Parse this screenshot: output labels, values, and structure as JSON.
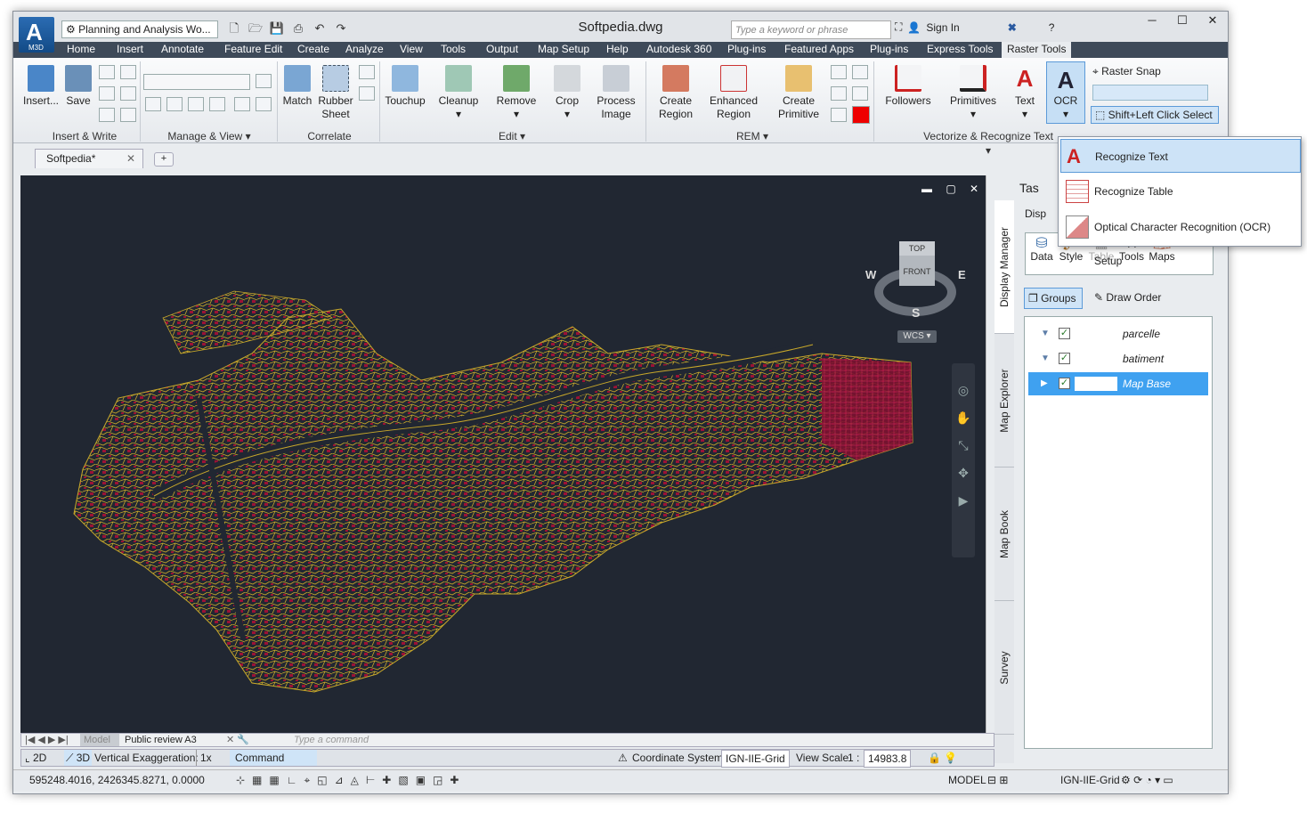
{
  "app": {
    "logo": "A",
    "logo_sub": "M3D",
    "workspace": "Planning and Analysis Wo...",
    "title": "Softpedia.dwg",
    "search_placeholder": "Type a keyword or phrase",
    "sign_in": "Sign In"
  },
  "tabs": [
    "Home",
    "Insert",
    "Annotate",
    "Feature Edit",
    "Create",
    "Analyze",
    "View",
    "Tools",
    "Output",
    "Map Setup",
    "Help",
    "Autodesk 360",
    "Plug-ins",
    "Featured Apps",
    "Plug-ins",
    "Express Tools",
    "Raster Tools"
  ],
  "ribbon": {
    "insert_write": {
      "insert": "Insert...",
      "save": "Save",
      "panel": "Insert & Write"
    },
    "manage_view": {
      "panel": "Manage & View"
    },
    "correlate": {
      "match": "Match",
      "rubber": "Rubber",
      "sheet": "Sheet",
      "panel": "Correlate"
    },
    "edit": {
      "touchup": "Touchup",
      "cleanup": "Cleanup",
      "remove": "Remove",
      "crop": "Crop",
      "process": "Process",
      "image": "Image",
      "panel": "Edit"
    },
    "rem": {
      "create": "Create",
      "region": "Region",
      "enhanced": "Enhanced",
      "enh_region": "Region",
      "create2": "Create",
      "primitive": "Primitive",
      "panel": "REM"
    },
    "vector": {
      "followers": "Followers",
      "primitives": "Primitives",
      "text": "Text",
      "ocr": "OCR",
      "panel": "Vectorize & Recognize Text",
      "raster_snap": "Raster Snap",
      "shift_select": "Shift+Left Click Select"
    }
  },
  "doc_tab": "Softpedia*",
  "compass": {
    "top": "TOP",
    "front": "FRONT",
    "n": "",
    "w": "W",
    "e": "E",
    "s": "S",
    "wcs": "WCS"
  },
  "ocr_menu": [
    "Recognize Text",
    "Recognize Table",
    "Optical Character Recognition (OCR) Setup"
  ],
  "palette": {
    "title": "Tas",
    "display_tab": "Disp",
    "vtabs": [
      "Display Manager",
      "Map Explorer",
      "Map Book",
      "Survey"
    ],
    "tools": [
      "Data",
      "Style",
      "Table",
      "Tools",
      "Maps"
    ],
    "groups": "Groups",
    "draw_order": "Draw Order",
    "layers": [
      {
        "name": "parcelle",
        "checked": true
      },
      {
        "name": "batiment",
        "checked": true
      },
      {
        "name": "Map Base",
        "checked": true
      }
    ]
  },
  "layout_tabs": {
    "model": "Model",
    "layout": "Public review A3"
  },
  "command": {
    "placeholder": "Type  a  command",
    "label": "Command"
  },
  "status": {
    "d2": "2D",
    "d3": "3D",
    "vert": "Vertical Exaggeration:",
    "vert_val": "1x",
    "coord_label": "Coordinate System:",
    "coord_val": "IGN-IIE-Grid",
    "scale_label": "View Scale",
    "scale_one": "1 :",
    "scale_val": "14983.8"
  },
  "bottom": {
    "coords": "595248.4016, 2426345.8271, 0.0000",
    "model": "MODEL",
    "grid": "IGN-IIE-Grid"
  },
  "colors": {
    "ribbon_tab_bg": "#3e4a59",
    "canvas": "#212732",
    "parcel": "#c8a82a",
    "building": "#9b1235",
    "highlight": "#3fa1f0"
  }
}
